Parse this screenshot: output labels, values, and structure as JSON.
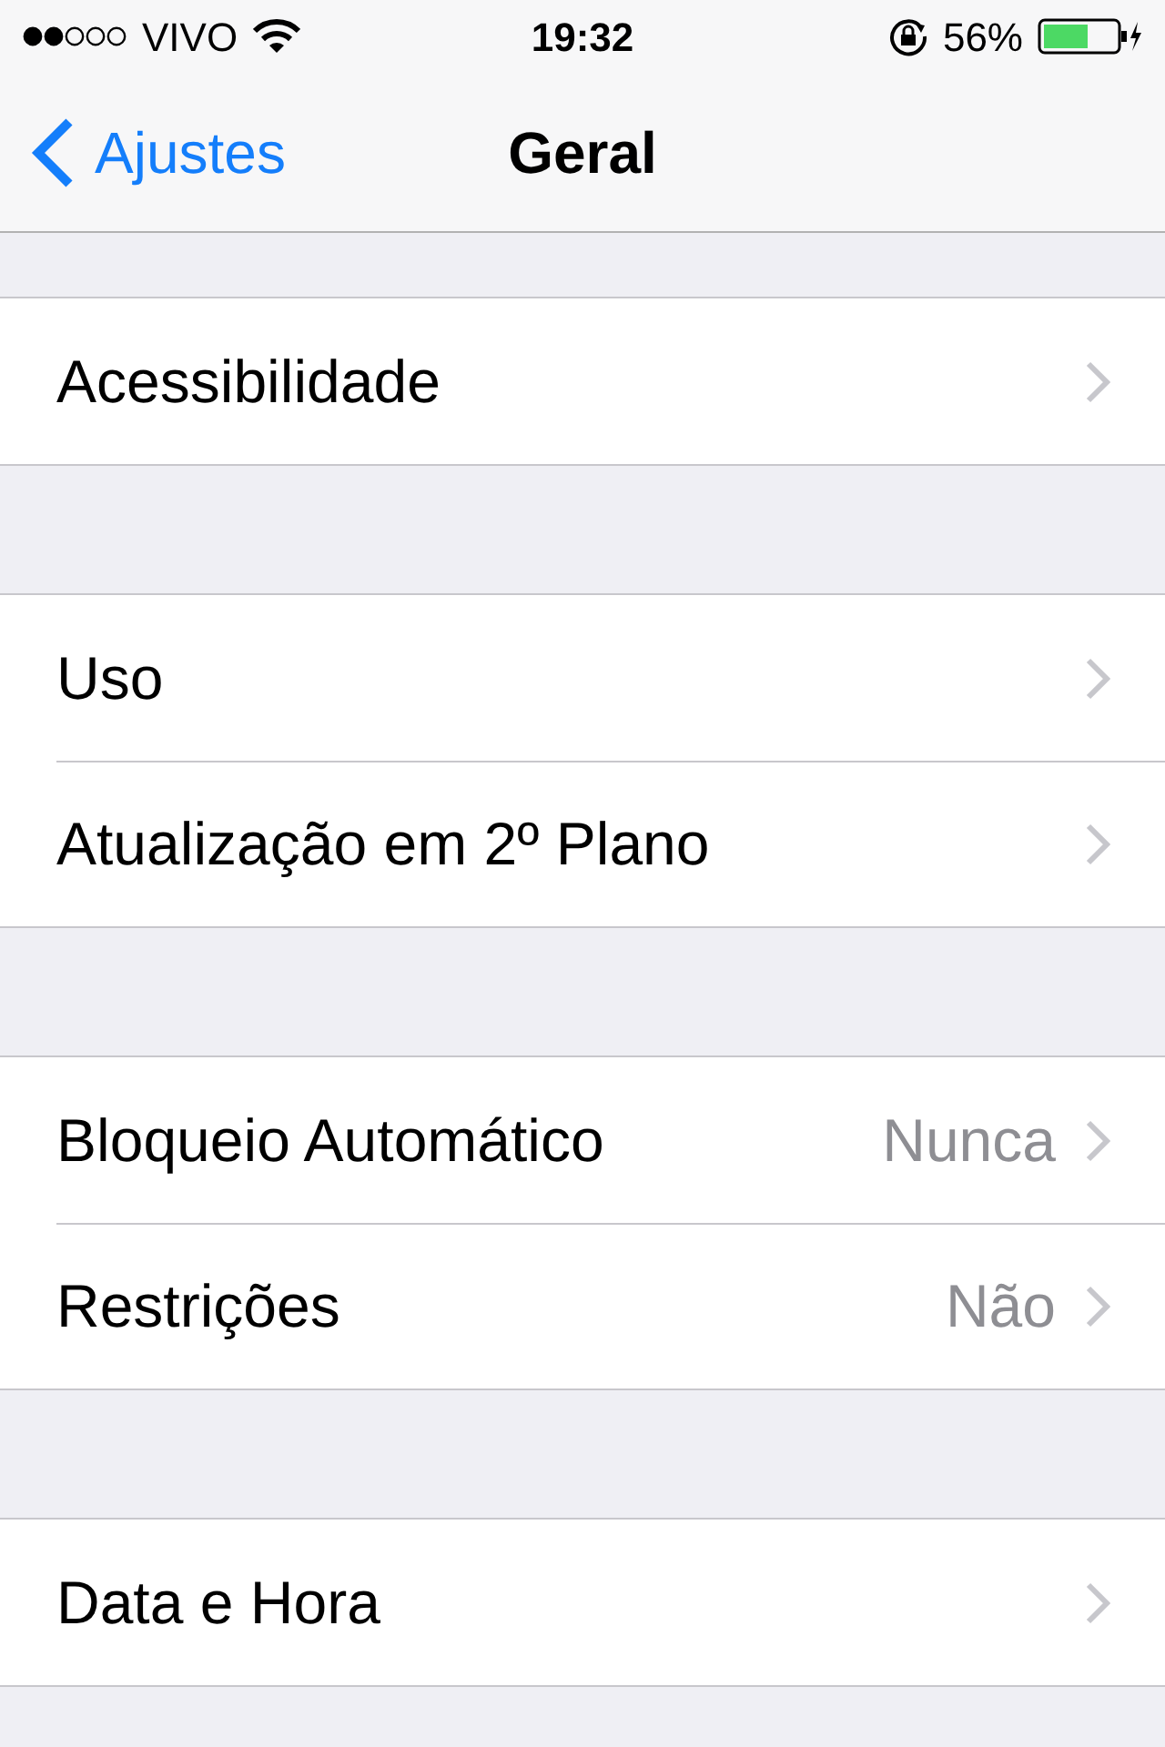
{
  "status_bar": {
    "carrier": "VIVO",
    "time": "19:32",
    "battery": "56%"
  },
  "nav": {
    "back": "Ajustes",
    "title": "Geral"
  },
  "groups": [
    {
      "rows": [
        {
          "label": "Acessibilidade"
        }
      ]
    },
    {
      "rows": [
        {
          "label": "Uso"
        },
        {
          "label": "Atualização em 2º Plano"
        }
      ]
    },
    {
      "rows": [
        {
          "label": "Bloqueio Automático",
          "detail": "Nunca"
        },
        {
          "label": "Restrições",
          "detail": "Não"
        }
      ]
    },
    {
      "rows": [
        {
          "label": "Data e Hora"
        }
      ]
    }
  ]
}
